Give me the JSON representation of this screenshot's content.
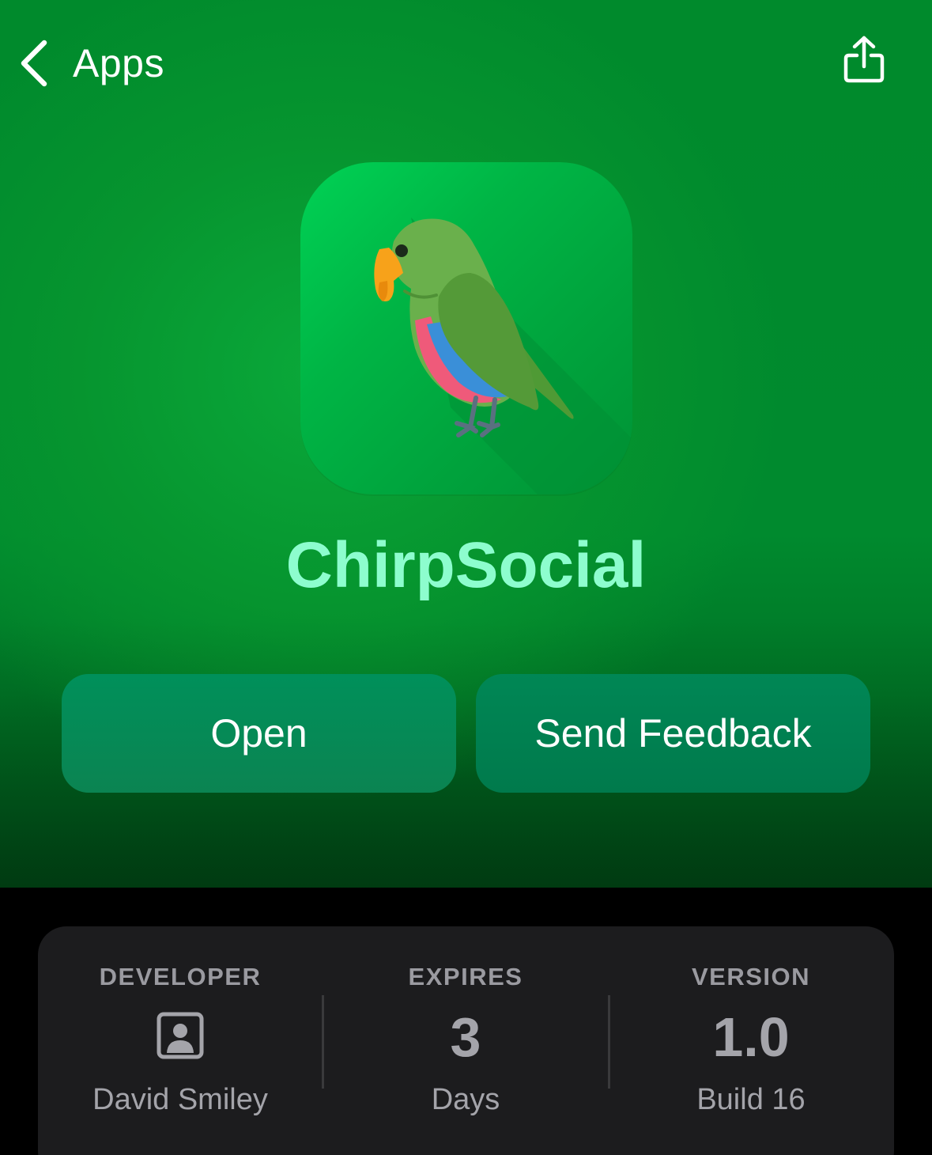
{
  "nav": {
    "back_label": "Apps",
    "back_icon": "chevron-left-icon",
    "share_icon": "share-icon"
  },
  "app": {
    "name": "ChirpSocial",
    "icon": "parrot-icon"
  },
  "actions": {
    "open_label": "Open",
    "feedback_label": "Send Feedback"
  },
  "info": {
    "developer": {
      "heading": "DEVELOPER",
      "icon": "person-icon",
      "value": "David Smiley"
    },
    "expires": {
      "heading": "EXPIRES",
      "value": "3",
      "unit": "Days"
    },
    "version": {
      "heading": "VERSION",
      "value": "1.0",
      "build": "Build 16"
    }
  },
  "colors": {
    "accent": "#8dfdce",
    "hero_green": "#008a2e",
    "button_green": "#00905a",
    "card_bg": "#1c1c1e"
  }
}
